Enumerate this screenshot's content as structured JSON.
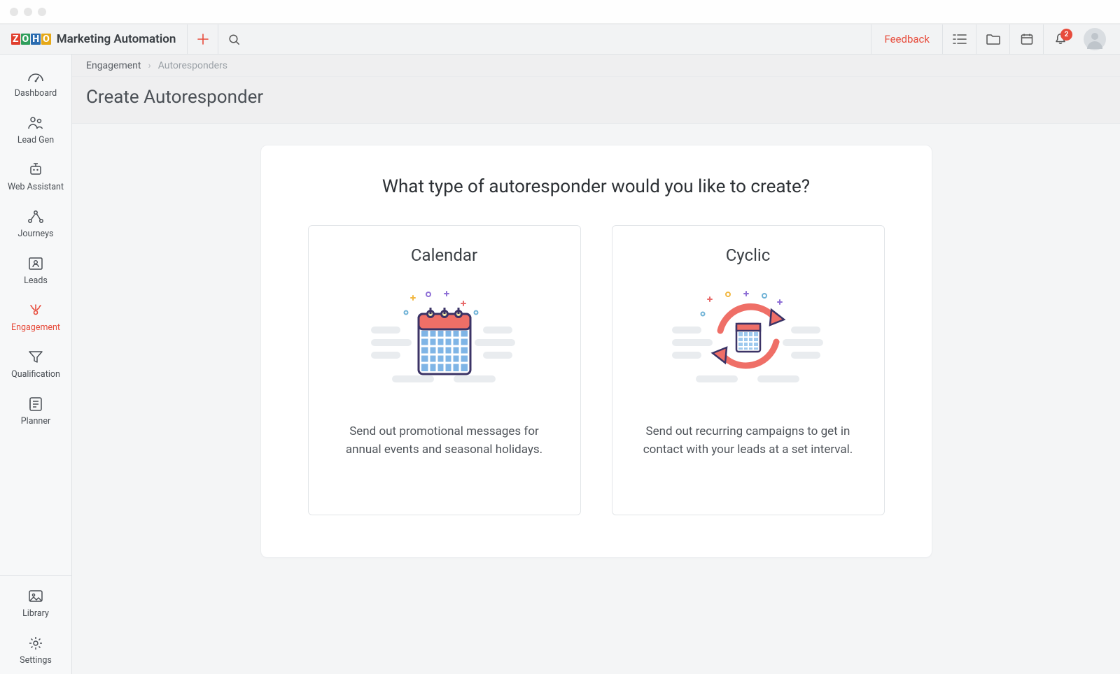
{
  "brand": {
    "name": "Marketing Automation"
  },
  "topbar": {
    "feedback": "Feedback",
    "notification_count": "2"
  },
  "sidebar": {
    "items": [
      {
        "id": "dashboard",
        "label": "Dashboard"
      },
      {
        "id": "leadgen",
        "label": "Lead Gen"
      },
      {
        "id": "webassistant",
        "label": "Web Assistant"
      },
      {
        "id": "journeys",
        "label": "Journeys"
      },
      {
        "id": "leads",
        "label": "Leads"
      },
      {
        "id": "engagement",
        "label": "Engagement"
      },
      {
        "id": "qualification",
        "label": "Qualification"
      },
      {
        "id": "planner",
        "label": "Planner"
      }
    ],
    "bottom": [
      {
        "id": "library",
        "label": "Library"
      },
      {
        "id": "settings",
        "label": "Settings"
      }
    ]
  },
  "breadcrumb": {
    "parent": "Engagement",
    "current": "Autoresponders"
  },
  "page": {
    "title": "Create Autoresponder"
  },
  "panel": {
    "heading": "What type of autoresponder would you like to create?",
    "options": [
      {
        "id": "calendar",
        "title": "Calendar",
        "desc": "Send out promotional messages for annual events and seasonal holidays."
      },
      {
        "id": "cyclic",
        "title": "Cyclic",
        "desc": "Send out recurring campaigns to get in contact with your leads at a set interval."
      }
    ]
  }
}
